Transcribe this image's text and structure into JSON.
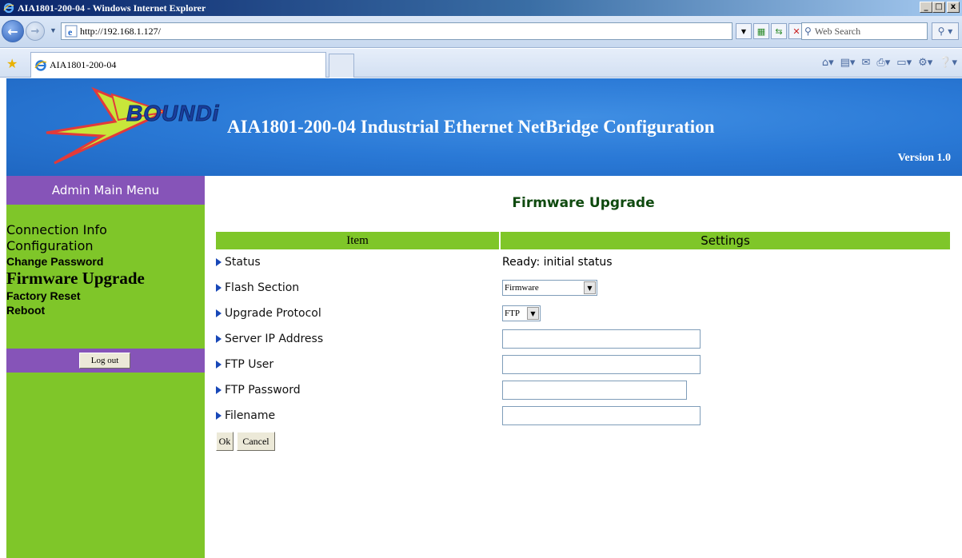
{
  "window": {
    "title": "AIA1801-200-04 - Windows Internet Explorer",
    "controls": {
      "minimize": "_",
      "maximize": "□",
      "close": "x"
    }
  },
  "browser": {
    "url": "http://192.168.1.127/",
    "search_placeholder": "Web Search",
    "tab_title": "AIA1801-200-04",
    "icons": [
      "back-icon",
      "forward-icon",
      "ie-icon",
      "refresh-icon",
      "stop-icon",
      "search-icon",
      "favorites-star-icon",
      "home-icon",
      "feeds-icon",
      "mail-icon",
      "print-icon",
      "page-icon",
      "tools-icon",
      "help-icon"
    ]
  },
  "banner": {
    "logo_text": "BOUNDi",
    "title": "AIA1801-200-04 Industrial Ethernet NetBridge Configuration",
    "version": "Version 1.0"
  },
  "sidebar": {
    "header": "Admin Main Menu",
    "items": [
      {
        "label": "Connection Info"
      },
      {
        "label": "Configuration"
      },
      {
        "label": "Change Password"
      },
      {
        "label": "Firmware Upgrade"
      },
      {
        "label": "Factory Reset"
      },
      {
        "label": "Reboot"
      }
    ],
    "logout": "Log out"
  },
  "main": {
    "title": "Firmware Upgrade",
    "columns": {
      "item": "Item",
      "settings": "Settings"
    },
    "rows": [
      {
        "label": "Status",
        "value": "Ready: initial status"
      },
      {
        "label": "Flash Section",
        "value": "Firmware"
      },
      {
        "label": "Upgrade Protocol",
        "value": "FTP"
      },
      {
        "label": "Server IP Address",
        "value": ""
      },
      {
        "label": "FTP User",
        "value": ""
      },
      {
        "label": "FTP Password",
        "value": ""
      },
      {
        "label": "Filename",
        "value": ""
      }
    ],
    "buttons": {
      "ok": "Ok",
      "cancel": "Cancel"
    }
  },
  "colors": {
    "sidebar_green": "#7fc629",
    "sidebar_purple": "#8654b8",
    "banner_blue": "#2a79d6",
    "title_green": "#0f4a0f"
  }
}
